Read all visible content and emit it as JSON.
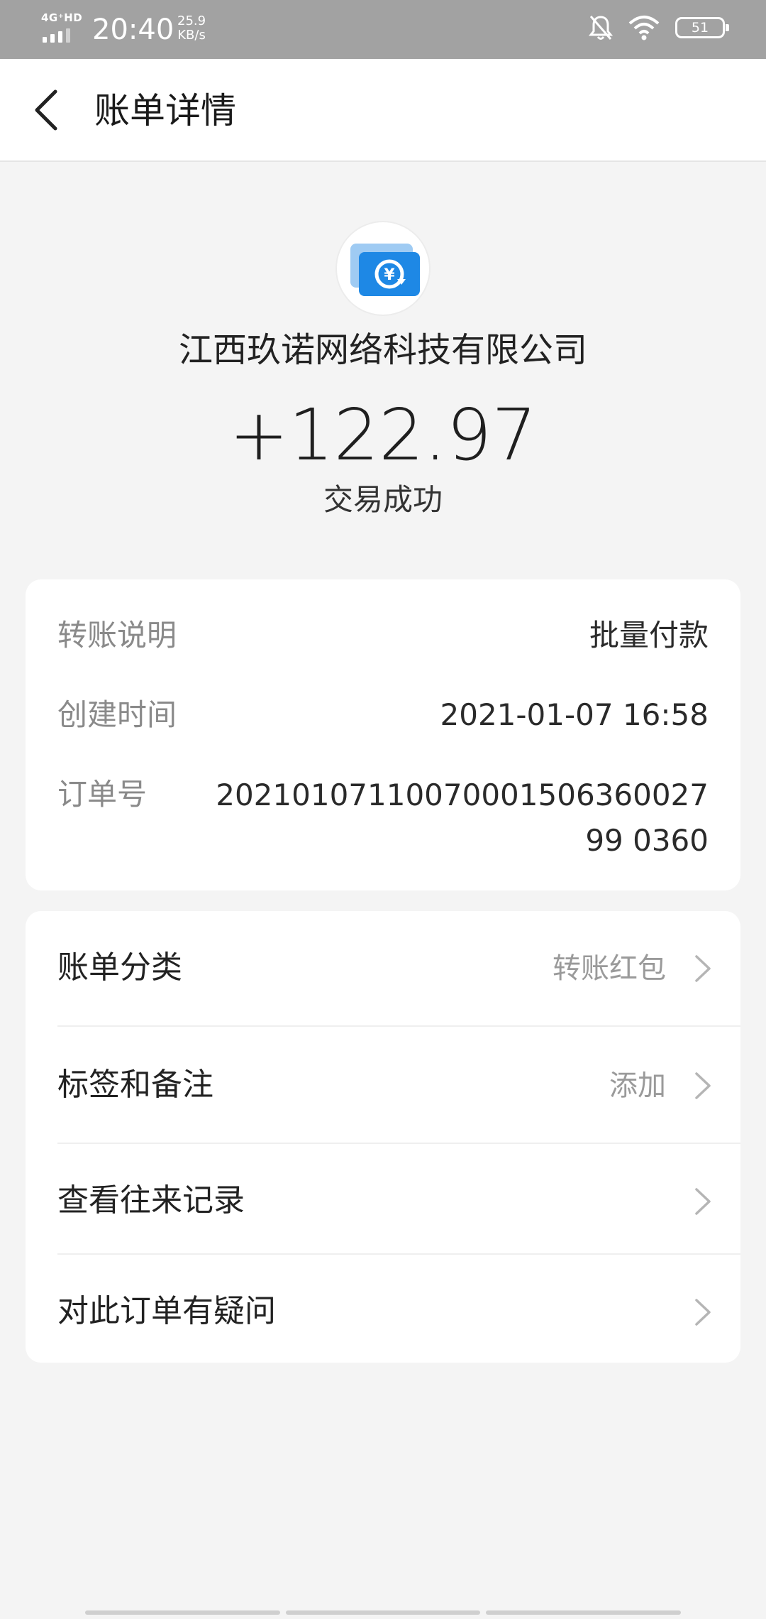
{
  "status_bar": {
    "network": "4G⁺HD",
    "time": "20:40",
    "speed_value": "25.9",
    "speed_unit": "KB/s",
    "battery": "51"
  },
  "app_bar": {
    "title": "账单详情"
  },
  "hero": {
    "merchant_name": "江西玖诺网络科技有限公司",
    "amount": "+122.97",
    "status": "交易成功"
  },
  "info": {
    "rows": [
      {
        "label": "转账说明",
        "value": "批量付款"
      },
      {
        "label": "创建时间",
        "value": "2021-01-07 16:58"
      },
      {
        "label": "订单号",
        "value": "2021010711007000150636002799 0360"
      }
    ]
  },
  "actions": [
    {
      "label": "账单分类",
      "value": "转账红包"
    },
    {
      "label": "标签和备注",
      "value": "添加"
    },
    {
      "label": "查看往来记录",
      "value": ""
    },
    {
      "label": "对此订单有疑问",
      "value": ""
    }
  ],
  "colors": {
    "status_bar_bg": "#a2a2a2",
    "page_bg": "#f4f4f4",
    "brand_blue": "#1e88e5"
  }
}
